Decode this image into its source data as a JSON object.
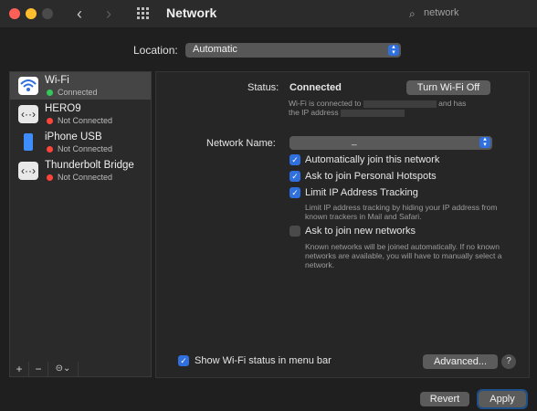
{
  "window": {
    "title": "Network"
  },
  "search": {
    "placeholder": "network"
  },
  "location": {
    "label": "Location:",
    "value": "Automatic"
  },
  "services": [
    {
      "name": "Wi-Fi",
      "status": "Connected",
      "status_color": "#34c759",
      "icon": "wifi-icon"
    },
    {
      "name": "HERO9",
      "status": "Not Connected",
      "status_color": "#ff453a",
      "icon": "ethernet-arrows-icon"
    },
    {
      "name": "iPhone USB",
      "status": "Not Connected",
      "status_color": "#ff453a",
      "icon": "iphone-icon"
    },
    {
      "name": "Thunderbolt Bridge",
      "status": "Not Connected",
      "status_color": "#ff453a",
      "icon": "ethernet-arrows-icon"
    }
  ],
  "sidebar_tools": {
    "add": "+",
    "remove": "−",
    "action": "⊝⌄"
  },
  "detail": {
    "status_label": "Status:",
    "status_value": "Connected",
    "turn_off_button": "Turn Wi-Fi Off",
    "status_desc_1a": "Wi-Fi is connected to",
    "status_desc_1b": "and has",
    "status_desc_2": "the IP address",
    "network_name_label": "Network Name:",
    "network_name_value": "_",
    "options": [
      {
        "label": "Automatically join this network",
        "checked": true
      },
      {
        "label": "Ask to join Personal Hotspots",
        "checked": true
      },
      {
        "label": "Limit IP Address Tracking",
        "checked": true
      }
    ],
    "limit_ip_desc": "Limit IP address tracking by hiding your IP address from known trackers in Mail and Safari.",
    "ask_new_label": "Ask to join new networks",
    "ask_new_checked": false,
    "ask_new_desc": "Known networks will be joined automatically. If no known networks are available, you will have to manually select a network.",
    "show_status_label": "Show Wi-Fi status in menu bar",
    "advanced_button": "Advanced...",
    "help": "?"
  },
  "footer": {
    "revert": "Revert",
    "apply": "Apply"
  }
}
